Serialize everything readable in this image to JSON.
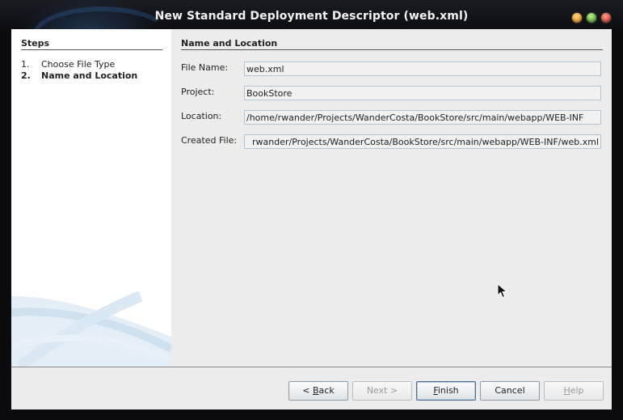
{
  "window": {
    "title": "New Standard Deployment Descriptor (web.xml)"
  },
  "steps": {
    "heading": "Steps",
    "items": [
      {
        "num": "1.",
        "label": "Choose File Type"
      },
      {
        "num": "2.",
        "label": "Name and Location"
      }
    ]
  },
  "main": {
    "heading": "Name and Location",
    "fields": [
      {
        "label": "File Name:",
        "value": "web.xml"
      },
      {
        "label": "Project:",
        "value": "BookStore"
      },
      {
        "label": "Location:",
        "value": "/home/rwander/Projects/WanderCosta/BookStore/src/main/webapp/WEB-INF"
      },
      {
        "label": "Created File:",
        "value": "rwander/Projects/WanderCosta/BookStore/src/main/webapp/WEB-INF/web.xml"
      }
    ]
  },
  "buttons": {
    "back": {
      "mnemonic": "B",
      "prefix": "< ",
      "rest": "ack"
    },
    "next": "Next >",
    "finish": {
      "mnemonic": "F",
      "rest": "inish"
    },
    "cancel": "Cancel",
    "help": {
      "mnemonic": "H",
      "rest": "elp"
    }
  },
  "colors": {
    "field_border": "#b4c4d2",
    "panel_bg": "#ececec",
    "titlebar_text": "#f2f2f2"
  }
}
